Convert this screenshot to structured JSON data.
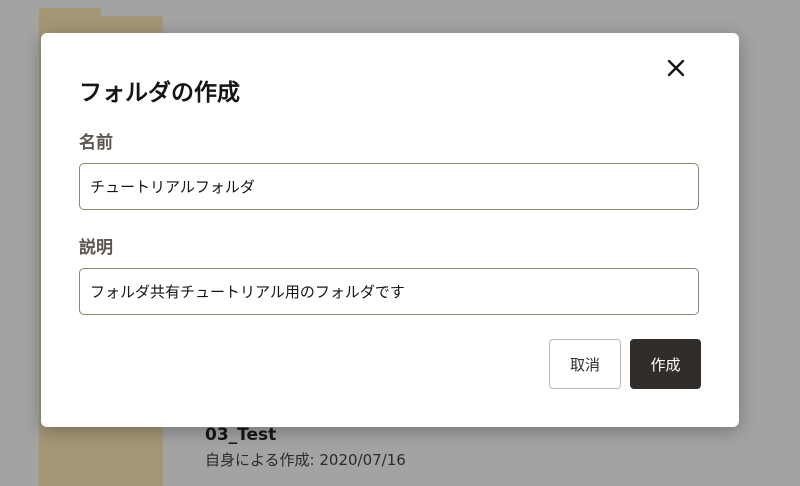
{
  "background": {
    "item_name": "03_Test",
    "item_meta": "自身による作成: 2020/07/16"
  },
  "dialog": {
    "title": "フォルダの作成",
    "close_icon": "close-icon",
    "name_label": "名前",
    "name_value": "チュートリアルフォルダ",
    "description_label": "説明",
    "description_value": "フォルダ共有チュートリアル用のフォルダです",
    "cancel_label": "取消",
    "create_label": "作成"
  },
  "colors": {
    "overlay": "#a3a3a3",
    "folder": "#a39776",
    "primary_button": "#312d2a",
    "input_border": "#8a8670"
  }
}
